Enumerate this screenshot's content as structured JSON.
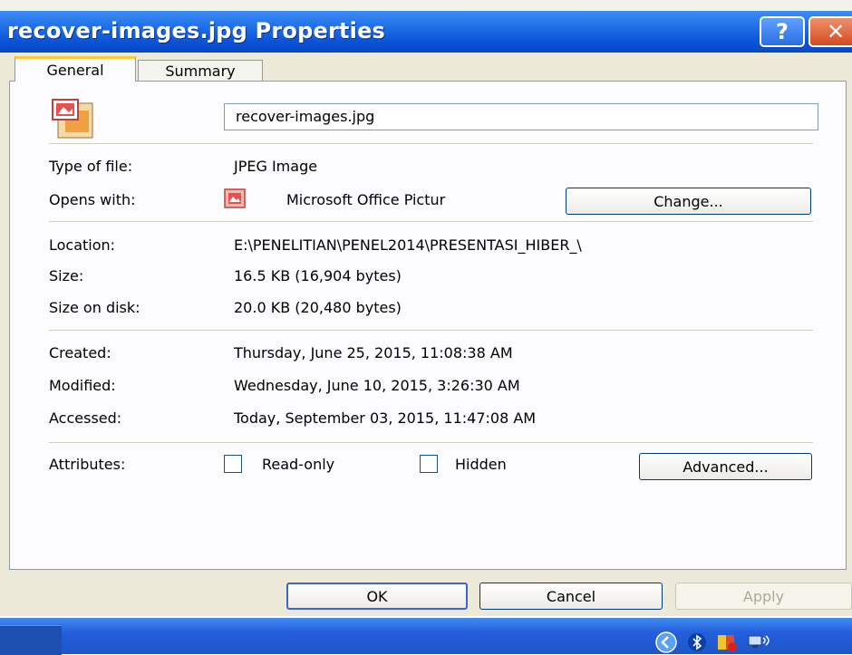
{
  "window": {
    "title": "recover-images.jpg Properties",
    "help_glyph": "?",
    "close_glyph": "✕"
  },
  "tabs": [
    {
      "label": "General",
      "active": true
    },
    {
      "label": "Summary",
      "active": false
    }
  ],
  "general": {
    "file_name": "recover-images.jpg",
    "type_label": "Type of file:",
    "type_value": "JPEG Image",
    "opens_label": "Opens with:",
    "opens_value": "Microsoft Office Pictur",
    "change_label": "Change...",
    "location_label": "Location:",
    "location_value": "E:\\PENELITIAN\\PENEL2014\\PRESENTASI_HIBER_\\",
    "size_label": "Size:",
    "size_value": "16.5 KB (16,904 bytes)",
    "size_disk_label": "Size on disk:",
    "size_disk_value": "20.0 KB (20,480 bytes)",
    "created_label": "Created:",
    "created_value": "Thursday, June 25, 2015, 11:08:38 AM",
    "modified_label": "Modified:",
    "modified_value": "Wednesday, June 10, 2015, 3:26:30 AM",
    "accessed_label": "Accessed:",
    "accessed_value": "Today, September 03, 2015, 11:47:08 AM",
    "attributes_label": "Attributes:",
    "readonly_label": "Read-only",
    "readonly_checked": false,
    "hidden_label": "Hidden",
    "hidden_checked": false,
    "advanced_label": "Advanced..."
  },
  "footer": {
    "ok_label": "OK",
    "cancel_label": "Cancel",
    "apply_label": "Apply",
    "apply_enabled": false
  },
  "taskbar": {
    "tray_icons": [
      "chevron-left-icon",
      "bluetooth-icon",
      "security-shield-icon",
      "network-icon"
    ]
  },
  "colors": {
    "titlebar": "#0a52d6",
    "dialog_bg": "#ece9d8",
    "tab_highlight": "#ffc83c"
  }
}
